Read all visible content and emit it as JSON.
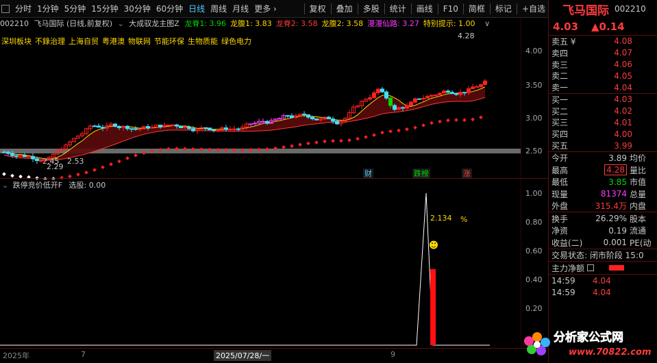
{
  "toolbar": {
    "left": [
      "分时",
      "1分钟",
      "5分钟",
      "15分钟",
      "30分钟",
      "60分钟",
      "日线",
      "周线",
      "月线",
      "更多 ›"
    ],
    "active_index": 6,
    "right": [
      "复权",
      "叠加",
      "多股",
      "统计",
      "画线",
      "F10",
      "简框",
      "标记",
      "+自选"
    ]
  },
  "main_header": {
    "code": "002210",
    "name": "飞马国际 (日线,前复权)",
    "indicator": "大成驭龙主图Z",
    "items": [
      {
        "label": "龙脊1: 3.96",
        "color": "#00d800"
      },
      {
        "label": "龙腹1: 3.83",
        "color": "#ffd800"
      },
      {
        "label": "龙脊2: 3.58",
        "color": "#ff3b3b"
      },
      {
        "label": "龙腹2: 3.58",
        "color": "#ffd800"
      },
      {
        "label": "漫漫仙路: 3.27",
        "color": "#ff3bff"
      },
      {
        "label": "特别提示: 1.00",
        "color": "#ffd800"
      }
    ]
  },
  "concepts": [
    "深圳板块",
    "不錄治理",
    "上海自贸",
    "粤港澳",
    "物联网",
    "节能环保",
    "生物质能",
    "绿色电力"
  ],
  "main_chart": {
    "y_ticks": [
      "4.00",
      "3.50",
      "3.00",
      "2.50"
    ],
    "annotations": {
      "high": "4.28",
      "low1": "2.45",
      "low2": "2.29",
      "low3": "2.53"
    },
    "markers": [
      {
        "label": "财",
        "color": "#4ec9ff"
      },
      {
        "label": "跌榜",
        "color": "#00d800"
      },
      {
        "label": "涨",
        "color": "#ff3b3b"
      }
    ]
  },
  "indicator": {
    "name": "跌停竞价低开F",
    "select_label": "选股: 0.00",
    "value_label": "2.134",
    "unit": "%",
    "y_ticks": [
      "1.00",
      "0.80",
      "0.60",
      "0.40",
      "0.20"
    ]
  },
  "date_axis": {
    "labels": [
      "2025年",
      "7",
      "2025/07/28/一",
      "9"
    ]
  },
  "quote": {
    "name": "飞马国际",
    "code": "002210",
    "price": "4.03",
    "change": "▲0.14",
    "asks": [
      {
        "label": "卖五 ¥",
        "price": "4.08"
      },
      {
        "label": "卖四",
        "price": "4.07"
      },
      {
        "label": "卖三",
        "price": "4.06"
      },
      {
        "label": "卖二",
        "price": "4.05"
      },
      {
        "label": "卖一",
        "price": "4.04"
      }
    ],
    "bids": [
      {
        "label": "买一",
        "price": "4.03"
      },
      {
        "label": "买二",
        "price": "4.02"
      },
      {
        "label": "买三",
        "price": "4.01"
      },
      {
        "label": "买四",
        "price": "4.00"
      },
      {
        "label": "买五",
        "price": "3.99"
      }
    ],
    "stats": [
      {
        "label": "今开",
        "value": "3.89",
        "label2": "均价",
        "color": "#c8c8c8"
      },
      {
        "label": "最高",
        "value": "4.28",
        "label2": "量比",
        "color": "#ff3b3b"
      },
      {
        "label": "最低",
        "value": "3.85",
        "label2": "市值",
        "color": "#00d800"
      },
      {
        "label": "现量",
        "value": "81374",
        "label2": "总量",
        "color": "#ff3bff"
      },
      {
        "label": "外盘",
        "value": "315.4万",
        "label2": "内盘",
        "color": "#ff3b3b"
      }
    ],
    "stats2": [
      {
        "label": "换手",
        "value": "26.29%",
        "label2": "股本"
      },
      {
        "label": "净资",
        "value": "0.19",
        "label2": "流通"
      },
      {
        "label": "收益(二)",
        "value": "0.001",
        "label2": "PE(动"
      }
    ],
    "status_label": "交易状态: 闭市阶段 15:0",
    "flow_label": "主力净额",
    "ticks": [
      {
        "time": "14:59",
        "price": "4.04"
      },
      {
        "time": "14:59",
        "price": "4.04"
      }
    ]
  },
  "watermark": {
    "text": "分析家公式网",
    "url": "www.70822.com"
  }
}
